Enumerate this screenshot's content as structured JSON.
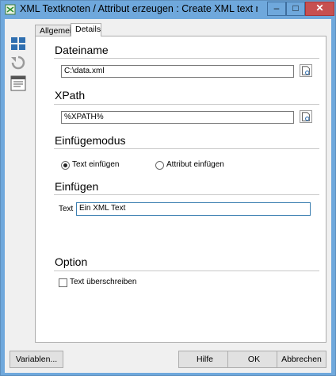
{
  "window": {
    "title": "XML Textknoten / Attribut erzeugen : Create XML text nod...",
    "minimize_label": "–",
    "maximize_label": "□",
    "close_label": "✕"
  },
  "tabs": [
    {
      "label": "Allgemein"
    },
    {
      "label": "Details"
    }
  ],
  "sections": {
    "dateiname": {
      "title": "Dateiname",
      "value": "C:\\data.xml"
    },
    "xpath": {
      "title": "XPath",
      "value": "%XPATH%"
    },
    "einfuegemodus": {
      "title": "Einfügemodus",
      "options": [
        {
          "label": "Text einfügen",
          "selected": true
        },
        {
          "label": "Attribut einfügen",
          "selected": false
        }
      ]
    },
    "einfuegen": {
      "title": "Einfügen",
      "text_label": "Text",
      "text_value": "Ein XML Text"
    },
    "option": {
      "title": "Option",
      "checkbox_label": "Text überschreiben",
      "checked": false
    }
  },
  "buttons": {
    "variables": "Variablen...",
    "help": "Hilfe",
    "ok": "OK",
    "cancel": "Abbrechen"
  },
  "icons": [
    "app-icon",
    "layout-icon",
    "undo-icon",
    "properties-icon",
    "browse-file-icon"
  ]
}
